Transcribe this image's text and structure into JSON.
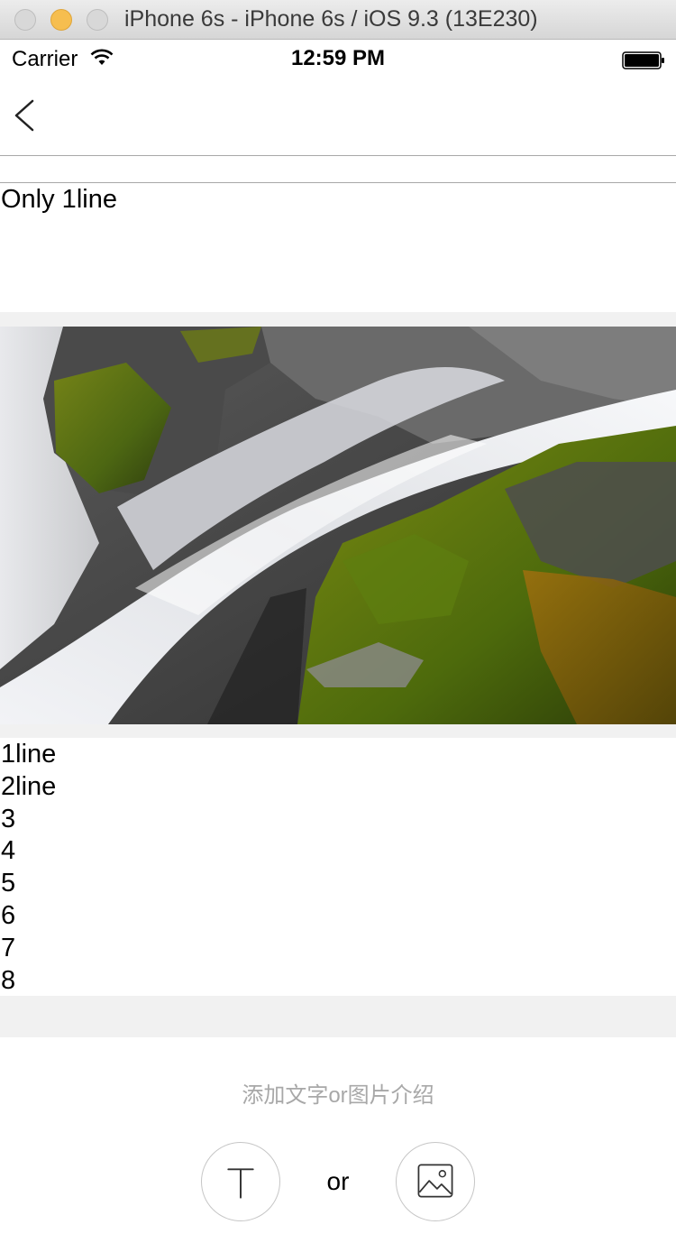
{
  "window": {
    "title": "iPhone 6s - iPhone 6s / iOS 9.3 (13E230)"
  },
  "status_bar": {
    "carrier": "Carrier",
    "time": "12:59 PM"
  },
  "nav": {
    "back_icon": "chevron-left-icon"
  },
  "content": {
    "first_block_text": "Only 1line",
    "image_alt": "waterfall over moss-covered rocks",
    "second_block_lines": [
      "1line",
      "2line",
      "3",
      "4",
      "5",
      "6",
      "7",
      "8"
    ]
  },
  "add_section": {
    "prompt": "添加文字or图片介绍",
    "separator": "or",
    "text_button_icon": "text-t-icon",
    "image_button_icon": "image-icon"
  },
  "colors": {
    "separator_bg": "#f1f1f1",
    "prompt_text": "#a8a8a8",
    "button_border": "#c6c6c6",
    "minimize_light": "#f6be4f"
  }
}
